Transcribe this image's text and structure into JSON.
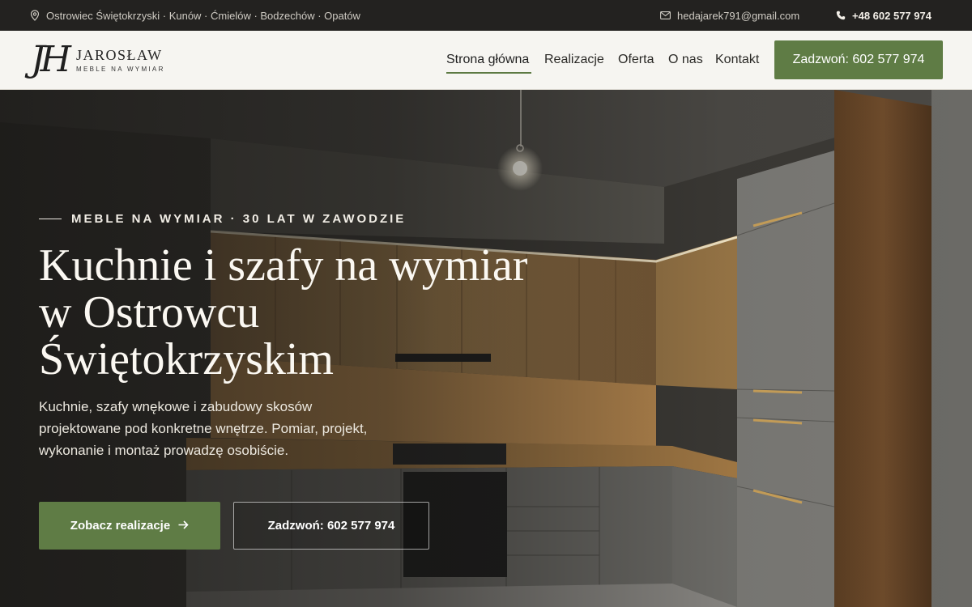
{
  "topbar": {
    "location": "Ostrowiec Świętokrzyski · Kunów · Ćmielów · Bodzechów · Opatów",
    "email": "hedajarek791@gmail.com",
    "phone": "+48 602 577 974"
  },
  "header": {
    "logo_mark": "JH",
    "logo_name": "JAROSŁAW",
    "logo_sub": "MEBLE NA WYMIAR",
    "nav": [
      {
        "label": "Strona główna",
        "active": true
      },
      {
        "label": "Realizacje"
      },
      {
        "label": "Oferta"
      },
      {
        "label": "O nas"
      },
      {
        "label": "Kontakt"
      }
    ],
    "cta": "Zadzwoń: 602 577 974"
  },
  "hero": {
    "eyebrow": "MEBLE NA WYMIAR · 30 LAT W ZAWODZIE",
    "title_line1": "Kuchnie i szafy na wymiar",
    "title_line2": "w Ostrowcu",
    "title_line3": "Świętokrzyskim",
    "lead": "Kuchnie, szafy wnękowe i zabudowy skosów projektowane pod konkretne wnętrze. Pomiar, projekt, wykonanie i montaż prowadzę osobiście.",
    "primary_button": "Zobacz realizacje",
    "secondary_button": "Zadzwoń: 602 577 974"
  },
  "colors": {
    "accent": "#5f7c45",
    "topbar": "#232220",
    "header_bg": "#f6f5f1"
  },
  "icons": {
    "location": "map-pin-icon",
    "email": "mail-icon",
    "phone": "phone-icon",
    "arrow": "arrow-right-icon"
  }
}
